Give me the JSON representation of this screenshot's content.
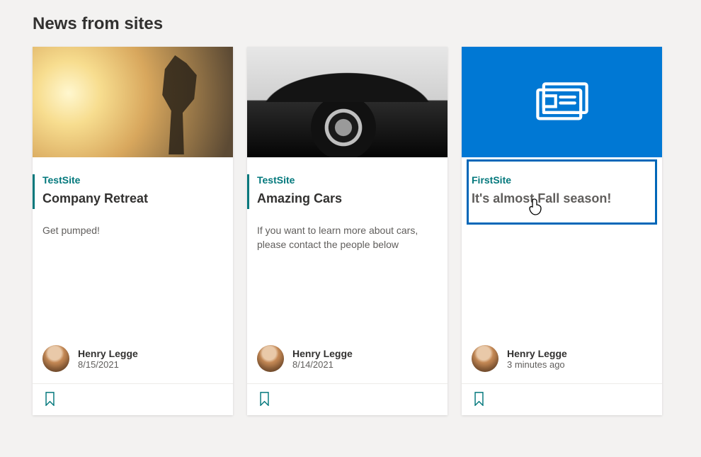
{
  "section_title": "News from sites",
  "cards": [
    {
      "site": "TestSite",
      "title": "Company Retreat",
      "description": "Get pumped!",
      "author_name": "Henry Legge",
      "date": "8/15/2021",
      "image_kind": "retreat",
      "highlighted": false
    },
    {
      "site": "TestSite",
      "title": "Amazing Cars",
      "description": "If you want to learn more about cars, please contact the people below",
      "author_name": "Henry Legge",
      "date": "8/14/2021",
      "image_kind": "cars",
      "highlighted": false
    },
    {
      "site": "FirstSite",
      "title": "It's almost Fall season!",
      "description": "",
      "author_name": "Henry Legge",
      "date": "3 minutes ago",
      "image_kind": "placeholder",
      "highlighted": true
    }
  ],
  "icons": {
    "bookmark": "bookmark-icon",
    "news_placeholder": "news-icon"
  }
}
